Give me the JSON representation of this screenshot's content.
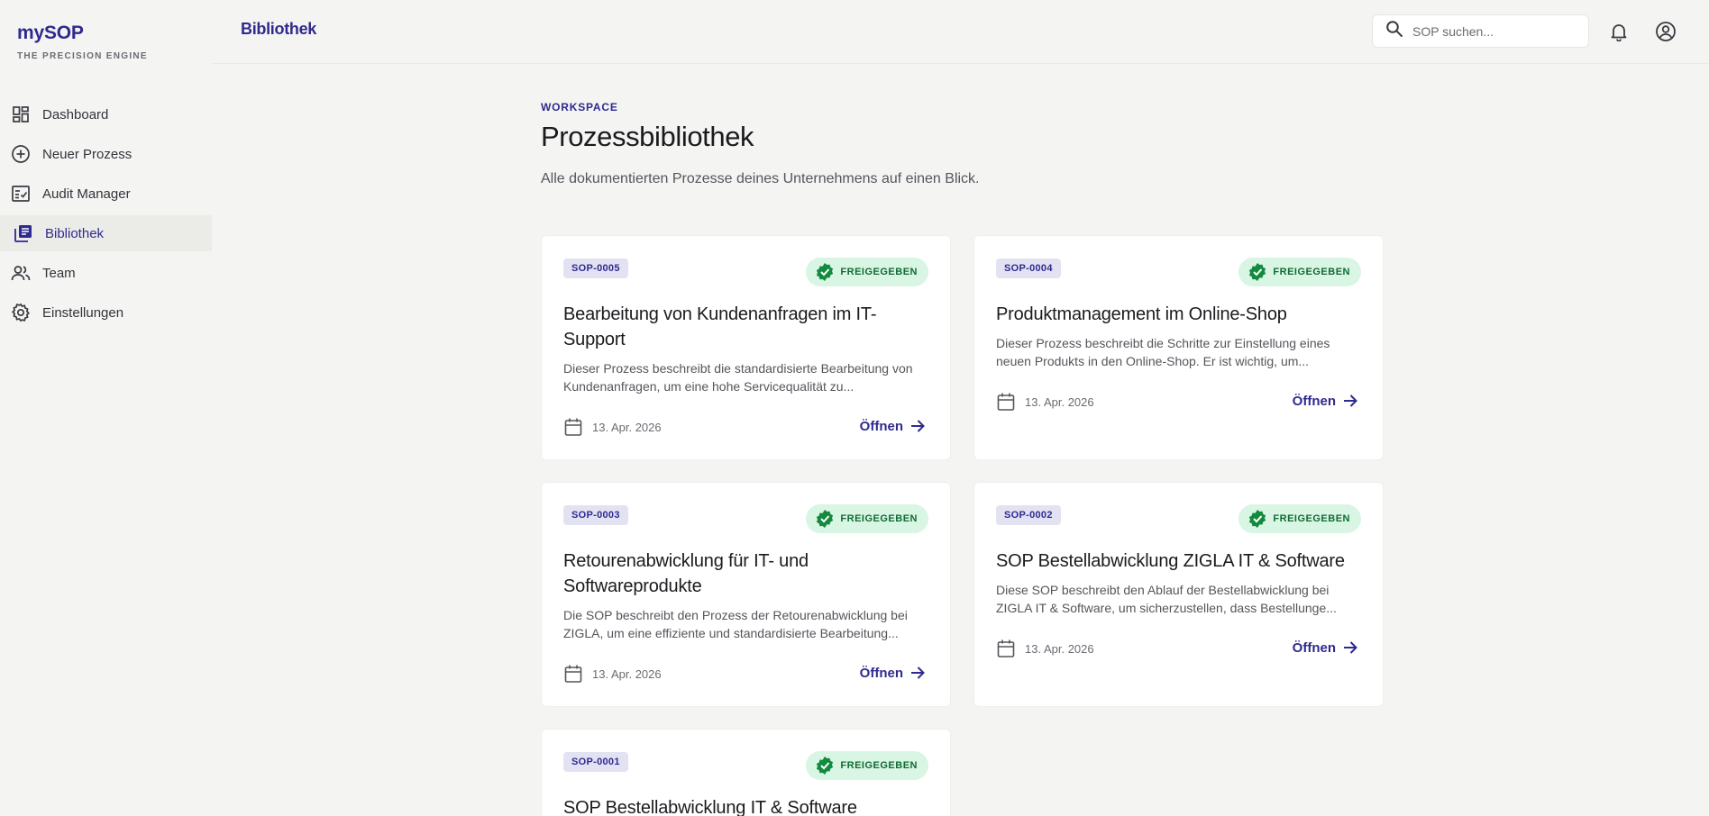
{
  "brand": {
    "name": "mySOP",
    "tagline": "THE PRECISION ENGINE"
  },
  "nav": [
    {
      "label": "Dashboard",
      "icon": "dashboard-icon",
      "active": false
    },
    {
      "label": "Neuer Prozess",
      "icon": "plus-circle-icon",
      "active": false
    },
    {
      "label": "Audit Manager",
      "icon": "checklist-icon",
      "active": false
    },
    {
      "label": "Bibliothek",
      "icon": "library-icon",
      "active": true
    },
    {
      "label": "Team",
      "icon": "team-icon",
      "active": false
    },
    {
      "label": "Einstellungen",
      "icon": "gear-icon",
      "active": false
    }
  ],
  "header": {
    "title": "Bibliothek",
    "search_placeholder": "SOP suchen..."
  },
  "page": {
    "eyebrow": "WORKSPACE",
    "title": "Prozessbibliothek",
    "subtitle": "Alle dokumentierten Prozesse deines Unternehmens auf einen Blick."
  },
  "colors": {
    "accent": "#2f2a8f",
    "status_bg": "#d9f5e3",
    "status_fg": "#0f6b34",
    "status_icon": "#138a3e",
    "id_bg": "#e3e2f3"
  },
  "cards": [
    {
      "id": "SOP-0005",
      "status": "FREIGEGEBEN",
      "title": "Bearbeitung von Kundenanfragen im IT-Support",
      "description": "Dieser Prozess beschreibt die standardisierte Bearbeitung von Kundenanfragen, um eine hohe Servicequalität zu...",
      "date": "13. Apr. 2026",
      "action": "Öffnen"
    },
    {
      "id": "SOP-0004",
      "status": "FREIGEGEBEN",
      "title": "Produktmanagement im Online-Shop",
      "description": "Dieser Prozess beschreibt die Schritte zur Einstellung eines neuen Produkts in den Online-Shop. Er ist wichtig, um...",
      "date": "13. Apr. 2026",
      "action": "Öffnen"
    },
    {
      "id": "SOP-0003",
      "status": "FREIGEGEBEN",
      "title": "Retourenabwicklung für IT- und Softwareprodukte",
      "description": "Die SOP beschreibt den Prozess der Retourenabwicklung bei ZIGLA, um eine effiziente und standardisierte Bearbeitung...",
      "date": "13. Apr. 2026",
      "action": "Öffnen"
    },
    {
      "id": "SOP-0002",
      "status": "FREIGEGEBEN",
      "title": "SOP Bestellabwicklung ZIGLA IT & Software",
      "description": "Diese SOP beschreibt den Ablauf der Bestellabwicklung bei ZIGLA IT & Software, um sicherzustellen, dass Bestellunge...",
      "date": "13. Apr. 2026",
      "action": "Öffnen"
    },
    {
      "id": "SOP-0001",
      "status": "FREIGEGEBEN",
      "title": "SOP Bestellabwicklung IT & Software",
      "description": "",
      "date": "",
      "action": ""
    }
  ]
}
